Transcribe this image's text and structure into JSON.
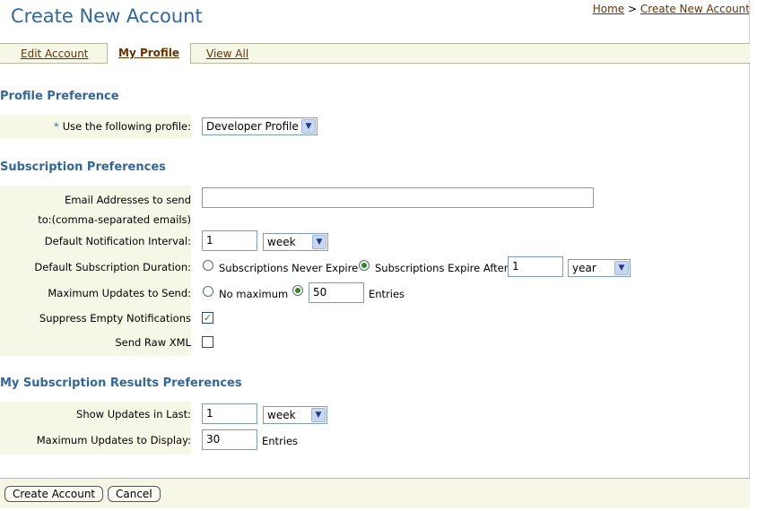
{
  "page_title": "Create New Account",
  "breadcrumb": {
    "home": "Home",
    "separator": ">",
    "current": "Create New Account"
  },
  "tabs": [
    {
      "label": "Edit Account",
      "active": false
    },
    {
      "label": "My Profile",
      "active": true
    },
    {
      "label": "View All",
      "active": false
    }
  ],
  "profile": {
    "section_title": "Profile Preference",
    "required_marker": "*",
    "profile_label": "Use the following profile:",
    "profile_value": "Developer Profile"
  },
  "subscription": {
    "section_title": "Subscription Preferences",
    "email_label_line1": "Email Addresses to send",
    "email_label_line2": "to:(comma-separated emails)",
    "email_value": "",
    "interval_label": "Default Notification Interval:",
    "interval_value": "1",
    "interval_unit": "week",
    "duration_label": "Default Subscription Duration:",
    "never_expire_label": "Subscriptions Never Expire",
    "expire_after_label": "Subscriptions Expire After",
    "duration_value": "1",
    "duration_unit": "year",
    "max_updates_label": "Maximum Updates to Send:",
    "no_max_label": "No maximum",
    "max_updates_value": "50",
    "entries_label": "Entries",
    "suppress_label": "Suppress Empty Notifications",
    "suppress_checked": true,
    "raw_xml_label": "Send Raw XML",
    "raw_xml_checked": false
  },
  "results": {
    "section_title": "My Subscription Results Preferences",
    "show_updates_label": "Show Updates in Last:",
    "show_updates_value": "1",
    "show_updates_unit": "week",
    "max_display_label": "Maximum Updates to Display:",
    "max_display_value": "30",
    "entries_label": "Entries"
  },
  "buttons": {
    "create": "Create Account",
    "cancel": "Cancel"
  },
  "colors": {
    "accent": "#336699",
    "link": "#663300",
    "panel": "#f7f7e7",
    "check": "#2e8b22"
  }
}
